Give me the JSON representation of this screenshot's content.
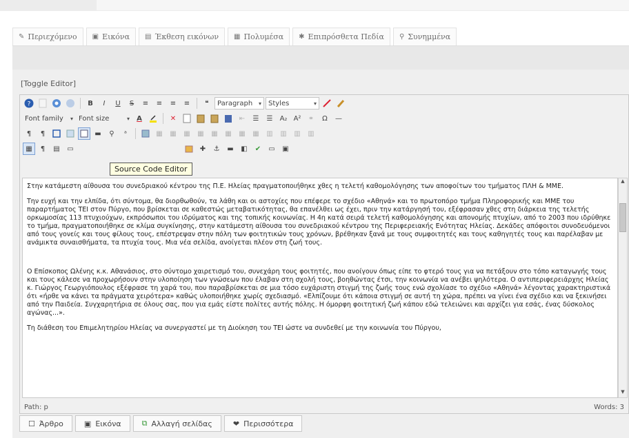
{
  "tabs": [
    {
      "icon": "✎",
      "icon_name": "edit-icon",
      "label": "Περιεχόμενο"
    },
    {
      "icon": "▣",
      "icon_name": "image-icon",
      "label": "Εικόνα"
    },
    {
      "icon": "▤",
      "icon_name": "gallery-icon",
      "label": "Έκθεση εικόνων"
    },
    {
      "icon": "▦",
      "icon_name": "multimedia-icon",
      "label": "Πολυμέσα"
    },
    {
      "icon": "✱",
      "icon_name": "extra-fields-icon",
      "label": "Επιπρόσθετα Πεδία"
    },
    {
      "icon": "⚲",
      "icon_name": "attachment-icon",
      "label": "Συνημμένα"
    }
  ],
  "editor": {
    "toggle_label": "[Toggle Editor]",
    "format_select": "Paragraph",
    "styles_select": "Styles",
    "font_family_select": "Font family",
    "font_size_select": "Font size",
    "tooltip": "Source Code Editor",
    "path_label": "Path: p",
    "words_label": "Words: 3",
    "paragraphs": [
      "Στην κατάμεστη αίθουσα του συνεδριακού κέντρου της Π.Ε. Ηλείας πραγματοποιήθηκε χθες η τελετή καθομολόγησης των αποφοίτων του τμήματος ΠΛΗ & ΜΜΕ.",
      "Την ευχή και την ελπίδα, ότι σύντομα, θα διορθωθούν, τα λάθη και οι αστοχίες που επέφερε το σχέδιο «Αθηνά» και το πρωτοπόρο τμήμα Πληροφορικής και ΜΜΕ του παραρτήματος ΤΕΙ στον Πύργο, που βρίσκεται σε καθεστώς μεταβατικότητας, θα επανέλθει ως έχει, πριν την κατάργησή του, εξέφρασαν χθες στη διάρκεια της τελετής ορκωμοσίας 113 πτυχιούχων, εκπρόσωποι του ιδρύματος και της τοπικής κοινωνίας. Η 4η κατά σειρά τελετή καθομολόγησης και απονομής πτυχίων, από το 2003 που ιδρύθηκε το τμήμα, πραγματοποιήθηκε σε κλίμα συγκίνησης, στην κατάμεστη αίθουσα του συνεδριακού κέντρου της Περιφερειακής Ενότητας Ηλείας. Δεκάδες απόφοιτοι συνοδευόμενοι από τους γονείς και τους φίλους τους, επέστρεψαν στην πόλη των φοιτητικών τους χρόνων, βρέθηκαν ξανά με τους συμφοιτητές και τους καθηγητές τους και παρέλαβαν με ανάμικτα συναισθήματα, τα πτυχία τους. Μια νέα σελίδα, ανοίγεται πλέον στη ζωή τους.",
      "Ο Επίσκοπος Ωλένης κ.κ. Αθανάσιος, στο σύντομο χαιρετισμό του, συνεχάρη τους φοιτητές, που ανοίγουν όπως είπε το φτερό τους για να πετάξουν στο τόπο καταγωγής τους και τους κάλεσε να προχωρήσουν στην υλοποίηση των γνώσεων που έλαβαν στη σχολή τους, βοηθώντας έτσι, την κοινωνία να ανέβει ψηλότερα. Ο αντιπεριφερειάρχης Ηλείας κ. Γιώργος Γεωργιόπουλος εξέφρασε τη χαρά του, που παραβρίσκεται σε μια τόσο ευχάριστη στιγμή της ζωής τους ενώ σχολίασε το σχέδιο «Αθηνά» λέγοντας χαρακτηριστικά ότι «ήρθε να κάνει τα πράγματα χειρότερα» καθώς υλοποιήθηκε χωρίς σχεδιασμό. «Ελπίζουμε ότι κάποια στιγμή σε αυτή τη χώρα, πρέπει να γίνει ένα σχέδιο και να ξεκινήσει από την Παιδεία. Συγχαρητήρια σε όλους σας, που για εμάς είστε πολίτες αυτής πόλης. Η όμορφη φοιτητική ζωή κάπου εδώ τελειώνει και αρχίζει για εσάς, ένας δύσκολος αγώνας...».",
      "Τη διάθεση του Επιμελητηρίου Ηλείας να συνεργαστεί με τη Διοίκηση του ΤΕΙ ώστε να συνδεθεί με την κοινωνία του Πύργου,"
    ]
  },
  "bottom_buttons": [
    {
      "icon": "☐",
      "icon_name": "article-icon",
      "label": "Άρθρο"
    },
    {
      "icon": "▣",
      "icon_name": "image-icon",
      "label": "Εικόνα"
    },
    {
      "icon": "⧉",
      "icon_name": "pagebreak-icon",
      "label": "Αλλαγή σελίδας"
    },
    {
      "icon": "❤",
      "icon_name": "heart-icon",
      "label": "Περισσότερα"
    }
  ],
  "colors": {
    "accent": "#7a9fd3",
    "tooltip_bg": "#ffffe1",
    "toolbar_bg": "#f0f0f0"
  }
}
